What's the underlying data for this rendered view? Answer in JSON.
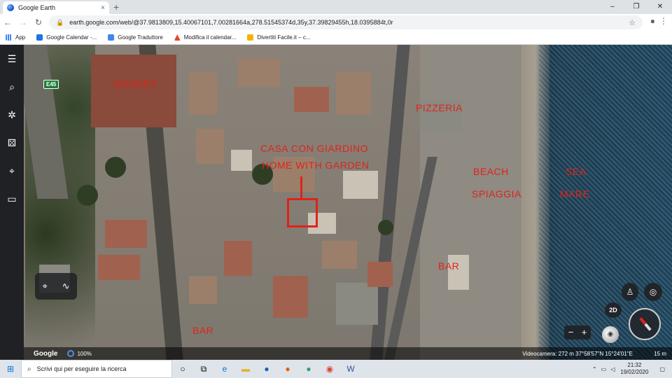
{
  "browser": {
    "tab_title": "Google Earth",
    "tab_close": "×",
    "new_tab": "+",
    "url": "earth.google.com/web/@37.9813809,15.40067101,7.00281664a,278.51545374d,35y,37.39829455h,18.0395884t,0r",
    "window_controls": [
      "–",
      "❐",
      "✕"
    ]
  },
  "bookmarks": [
    {
      "label": "App",
      "color": "#4285f4"
    },
    {
      "label": "Google Calendar -...",
      "color": "#1a73e8"
    },
    {
      "label": "Google Traduttore",
      "color": "#4285f4"
    },
    {
      "label": "Modifica il calendar...",
      "color": "#ea4335"
    },
    {
      "label": "Divertiti Facile.it – c...",
      "color": "#f4b400"
    }
  ],
  "map": {
    "labels": {
      "market": "MARKET",
      "pizzeria": "PIZZERIA",
      "casa": "CASA CON GIARDINO",
      "home": "HOME WITH GARDEN",
      "beach": "BEACH",
      "spiaggia": "SPIAGGIA",
      "sea": "SEA",
      "mare": "MARE",
      "bar1": "BAR",
      "bar2": "BAR"
    },
    "road_shield": "E45",
    "button_2d": "2D",
    "zoom_minus": "−",
    "zoom_plus": "+"
  },
  "status": {
    "logo": "Google",
    "zoom": "100%",
    "camera": "Videocamera: 272 m   37°58'57\"N 15°24'01\"E",
    "scale": "15 m"
  },
  "taskbar": {
    "search_placeholder": "Scrivi qui per eseguire la ricerca",
    "time": "21:32",
    "date": "19/02/2020"
  },
  "colors": {
    "label_red": "#e0231a",
    "sidebar": "#202124"
  }
}
